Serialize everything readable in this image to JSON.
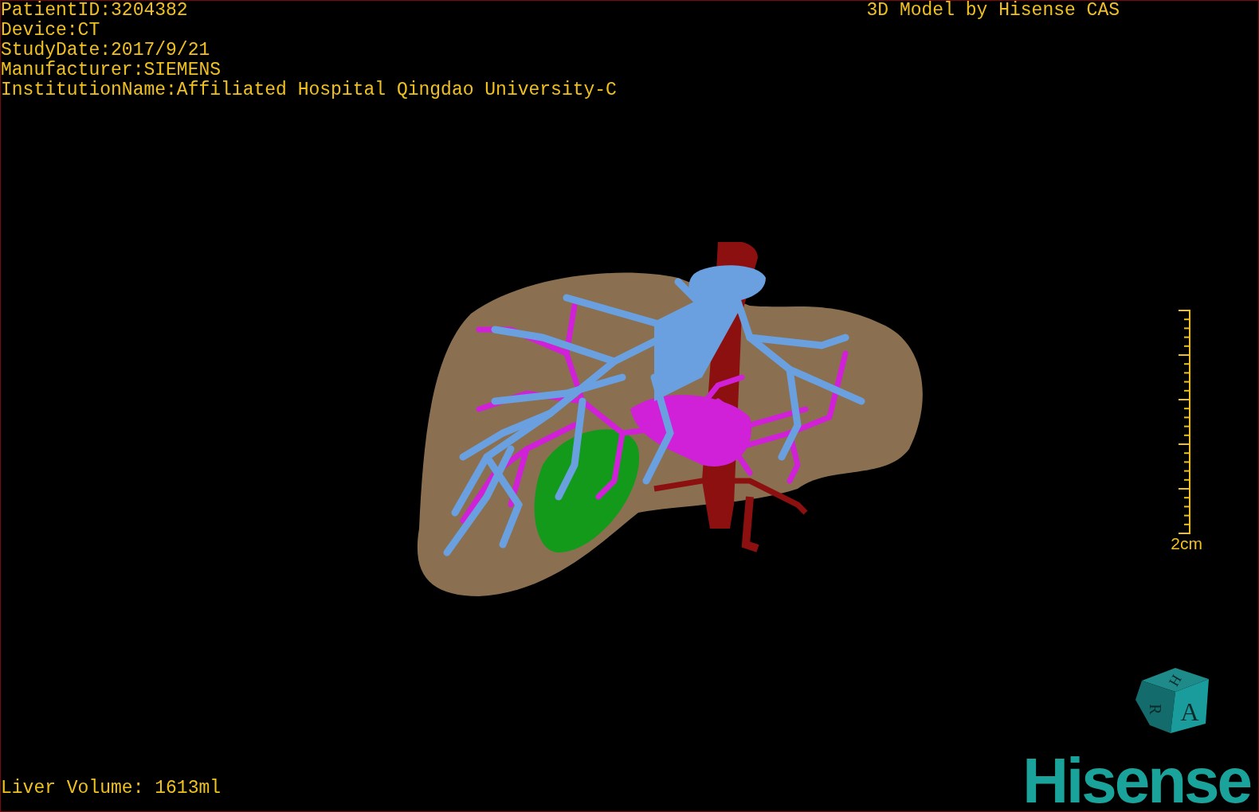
{
  "study_info": [
    "PatientID:3204382",
    "Device:CT",
    "StudyDate:2017/9/21",
    "Manufacturer:SIEMENS",
    "InstitutionName:Affiliated Hospital Qingdao University-C"
  ],
  "viewer_title": "3D Model by Hisense CAS",
  "scale_bar": {
    "label": "2cm"
  },
  "liver_volume": "Liver Volume: 1613ml",
  "orientation_cube": {
    "top": "H",
    "side": "R",
    "front": "A"
  },
  "logo": "Hisense"
}
